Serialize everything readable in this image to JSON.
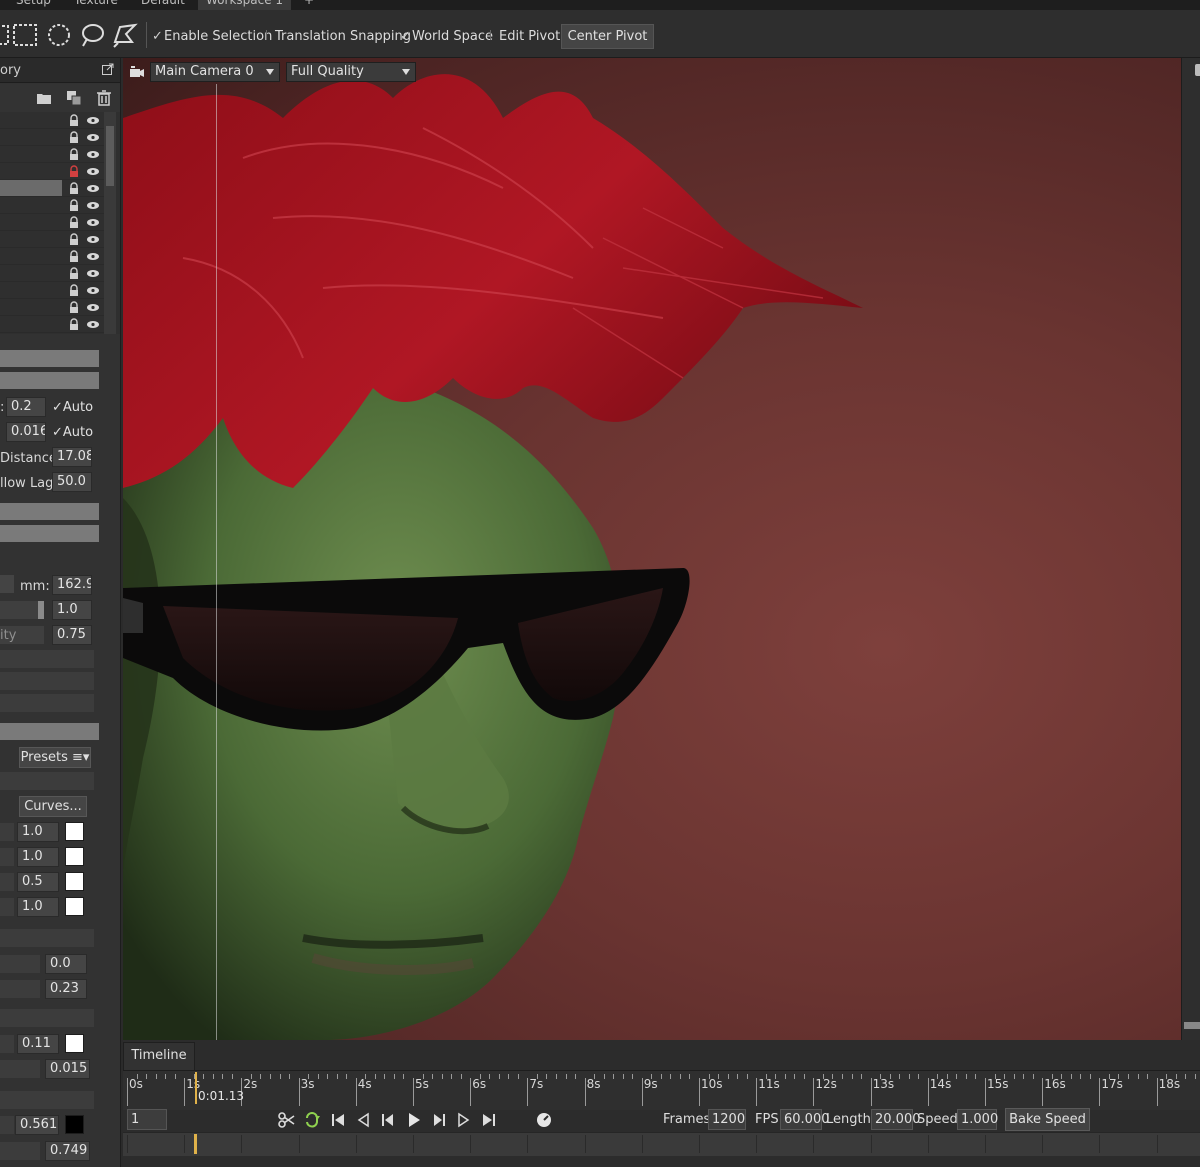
{
  "tabs": [
    "Setup",
    "Texture",
    "Default",
    "Workspace 1",
    "+"
  ],
  "toolbar": {
    "enable_selection": "Enable Selection",
    "translation_snapping": "Translation Snapping",
    "world_space": "World Space",
    "edit_pivot": "Edit Pivot",
    "center_pivot": "Center Pivot",
    "check_mark": "✓"
  },
  "left_panel": {
    "header_title": "ory",
    "rows": [
      {
        "label": ":",
        "value": "0.2",
        "auto": "Auto",
        "auto_mark": "✓"
      },
      {
        "label": "",
        "value": "0.016",
        "auto": "Auto",
        "auto_mark": "✓"
      },
      {
        "label": "Distance:",
        "value": "17.08"
      },
      {
        "label": "llow Lag",
        "value": "50.0"
      }
    ],
    "focal": {
      "left": "8",
      "label": "mm:",
      "value": "162.9"
    },
    "value_1": "1.0",
    "ity_label": "ity",
    "value_075": "0.75",
    "presets_label": "Presets",
    "presets_icon": "≡▾",
    "curves_label": "Curves...",
    "channels": [
      "1.0",
      "1.0",
      "0.5",
      "1.0"
    ],
    "pair_a": [
      "0.0",
      "0.23"
    ],
    "value_011": "0.11",
    "value_0015": "0.015",
    "value_0561": "0.561",
    "value_0749": "0.749"
  },
  "viewport": {
    "camera": "Main Camera 0",
    "quality": "Full Quality"
  },
  "timeline": {
    "tab": "Timeline",
    "ticks": [
      "0s",
      "1s",
      "2s",
      "3s",
      "4s",
      "5s",
      "6s",
      "7s",
      "8s",
      "9s",
      "10s",
      "11s",
      "12s",
      "13s",
      "14s",
      "15s",
      "16s",
      "17s",
      "18s"
    ],
    "current_time": "0:01.13",
    "frame": "1",
    "frames_label": "Frames",
    "frames": "1200",
    "fps_label": "FPS",
    "fps": "60.000",
    "length_label": "Length",
    "length": "20.000",
    "speed_label": "Speed",
    "speed": "1.000",
    "bake_speed": "Bake Speed"
  },
  "colors": {
    "playhead": "#e0b24a",
    "lock_active": "#d24040",
    "background": "#6a3431",
    "skin": "#4c6a3a",
    "hair": "#a3121e"
  }
}
